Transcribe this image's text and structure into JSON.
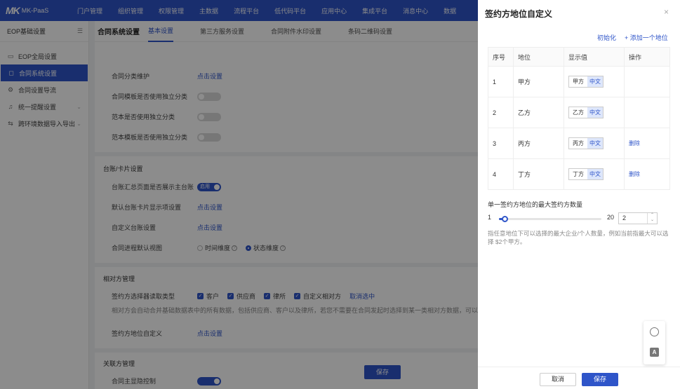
{
  "app": {
    "logo_mark": "MK",
    "logo_text": "MK-PaaS"
  },
  "topnav": [
    "门户管理",
    "组织管理",
    "权限管理",
    "主数据",
    "流程平台",
    "低代码平台",
    "应用中心",
    "集成平台",
    "消息中心",
    "数据"
  ],
  "sidebar": {
    "title": "EOP基础设置",
    "items": [
      {
        "label": "EOP全局设置",
        "icon": "monitor-icon",
        "glyph": "▭"
      },
      {
        "label": "合同系统设置",
        "icon": "contract-icon",
        "glyph": "◻"
      },
      {
        "label": "合同设置导流",
        "icon": "gear-icon",
        "glyph": "⚙"
      },
      {
        "label": "统一提醒设置",
        "icon": "bell-icon",
        "glyph": "♫",
        "chevron": "⌄"
      },
      {
        "label": "跨环境数据导入导出",
        "icon": "transfer-icon",
        "glyph": "⇆",
        "chevron": "⌄"
      }
    ]
  },
  "main": {
    "page_title": "合同系统设置",
    "tabs": [
      "基本设置",
      "第三方服务设置",
      "合同附件水印设置",
      "条码二维码设置"
    ],
    "rows": {
      "r1": {
        "label": "合同分类维护",
        "value": "点击设置"
      },
      "r2": {
        "label": "合同模板是否使用独立分类",
        "value": "禁用"
      },
      "r3": {
        "label": "范本是否使用独立分类",
        "value": "禁用"
      },
      "r4": {
        "label": "范本模板是否使用独立分类",
        "value": "禁用"
      },
      "s1": "台账/卡片设置",
      "r5": {
        "label": "台账汇总页面是否展示主台账",
        "value": "启用"
      },
      "r6": {
        "label": "默认台账卡片显示项设置",
        "value": "点击设置"
      },
      "r7": {
        "label": "自定义台账设置",
        "value": "点击设置"
      },
      "r8": {
        "label": "合同进程默认视图",
        "opt1": "时间维度",
        "opt2": "状态维度"
      },
      "s2": "相对方管理",
      "r9": {
        "label": "签约方选择器读取类型",
        "options": [
          "客户",
          "供应商",
          "律所",
          "自定义相对方"
        ],
        "action": "取消选中"
      },
      "r9_desc": "相对方会自动合并基础数据表中的所有数据，包括供应商、客户以及律所，若您不需要在合同发起时选择到某一类相对方数据，可以在此处取消",
      "r10": {
        "label": "签约方地位自定义",
        "value": "点击设置"
      },
      "s3": "关联方管理",
      "r11": {
        "label": "合同主显隐控制",
        "value": "禁用"
      }
    },
    "save_label": "保存"
  },
  "drawer": {
    "title": "签约方地位自定义",
    "close": "×",
    "reset_label": "初始化",
    "add_label": "+ 添加一个地位",
    "columns": [
      "序号",
      "地位",
      "显示值",
      "操作"
    ],
    "rows": [
      {
        "no": "1",
        "role": "甲方",
        "value": "甲方",
        "lang": "中文",
        "action": ""
      },
      {
        "no": "2",
        "role": "乙方",
        "value": "乙方",
        "lang": "中文",
        "action": ""
      },
      {
        "no": "3",
        "role": "丙方",
        "value": "丙方",
        "lang": "中文",
        "action": "删除"
      },
      {
        "no": "4",
        "role": "丁方",
        "value": "丁方",
        "lang": "中文",
        "action": "删除"
      }
    ],
    "max_label": "单一签约方地位的最大签约方数量",
    "slider": {
      "min": 1,
      "max": 20,
      "value": 2,
      "min_label": "1",
      "max_label": "20",
      "input_value": "2"
    },
    "hint": "指任意地位下可以选择的最大企业/个人数量，例如当前指最大可以选择 $2个甲方。",
    "cancel_label": "取消",
    "save_label": "保存"
  },
  "float_tools": {
    "icon1": "robot-icon",
    "icon2": "translate-icon",
    "icon2_glyph": "A"
  },
  "colors": {
    "primary": "#2f55c9",
    "overlay": "rgba(0,0,0,0.45)"
  }
}
